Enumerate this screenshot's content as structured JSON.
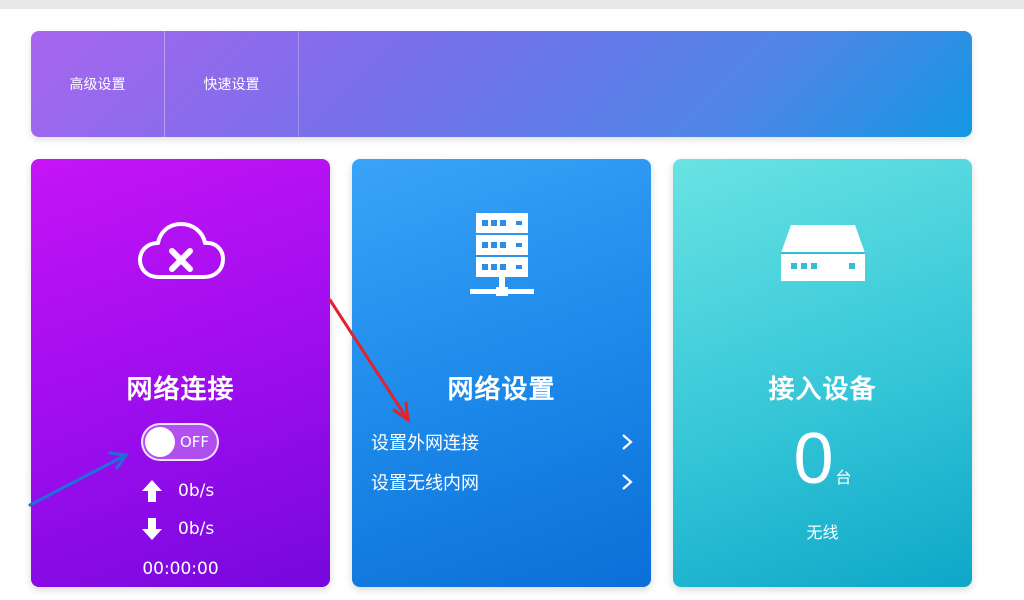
{
  "nav": {
    "tabs": [
      {
        "label": "高级设置"
      },
      {
        "label": "快速设置"
      }
    ]
  },
  "cards": {
    "network_connection": {
      "title": "网络连接",
      "icon": "cloud-x-icon",
      "toggle_label": "OFF",
      "toggle_state": "off",
      "upload_rate": "0b/s",
      "download_rate": "0b/s",
      "uptime": "00:00:00"
    },
    "network_settings": {
      "title": "网络设置",
      "icon": "server-icon",
      "links": [
        {
          "label": "设置外网连接"
        },
        {
          "label": "设置无线内网"
        }
      ]
    },
    "connected_devices": {
      "title": "接入设备",
      "icon": "router-icon",
      "count": "0",
      "unit": "台",
      "type_label": "无线"
    }
  },
  "annotations": {
    "red_arrow_color": "#e0232f",
    "blue_arrow_color": "#1f6fd6"
  }
}
